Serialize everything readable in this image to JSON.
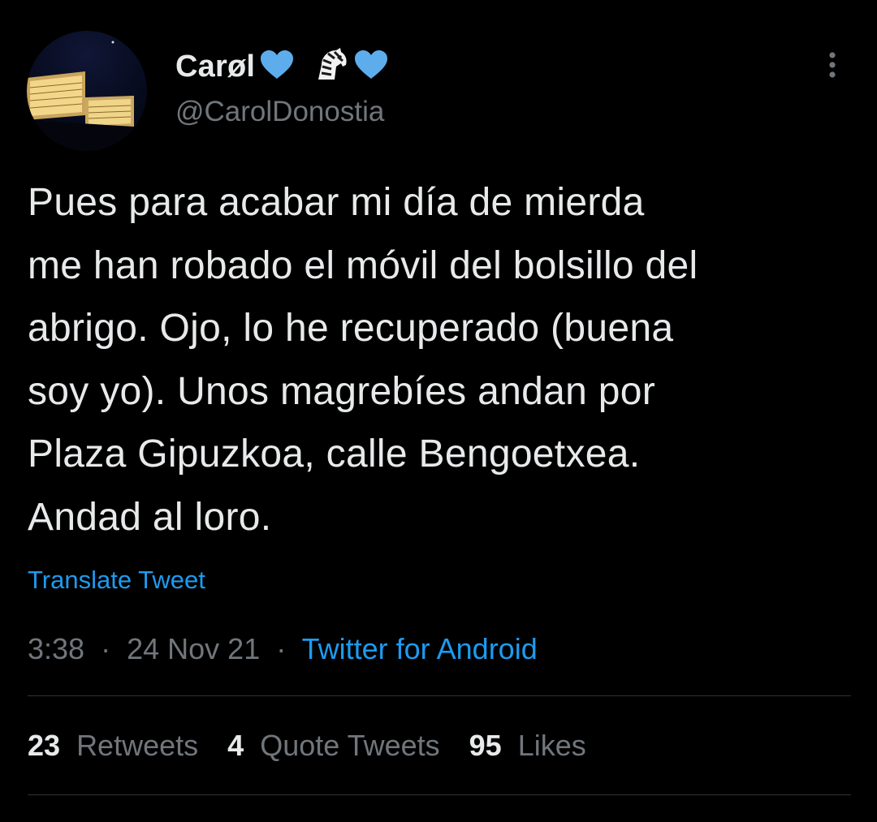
{
  "user": {
    "display_name": "Carøl",
    "handle": "@CarolDonostia",
    "emoji": [
      "blue-heart",
      "zebra-emoji",
      "blue-heart"
    ]
  },
  "tweet": {
    "lines": [
      "Pues para acabar mi día de mierda",
      "me han robado el móvil del bolsillo del",
      "abrigo. Ojo, lo he recuperado (buena",
      "soy yo). Unos magrebíes andan por",
      "Plaza Gipuzkoa, calle Bengoetxea.",
      "Andad al loro."
    ],
    "translate_label": "Translate Tweet"
  },
  "meta": {
    "time": "3:38",
    "separator": "·",
    "date": "24 Nov 21",
    "source": "Twitter for Android"
  },
  "stats": {
    "retweets_count": "23",
    "retweets_label": "Retweets",
    "quotes_count": "4",
    "quotes_label": "Quote Tweets",
    "likes_count": "95",
    "likes_label": "Likes"
  },
  "icons": {
    "more": "more-vertical-icon"
  },
  "colors": {
    "background": "#000000",
    "text": "#E7E9EA",
    "secondary": "#71767B",
    "accent": "#1D9BF0",
    "divider": "#2F3336",
    "heart": "#5DADEC"
  }
}
